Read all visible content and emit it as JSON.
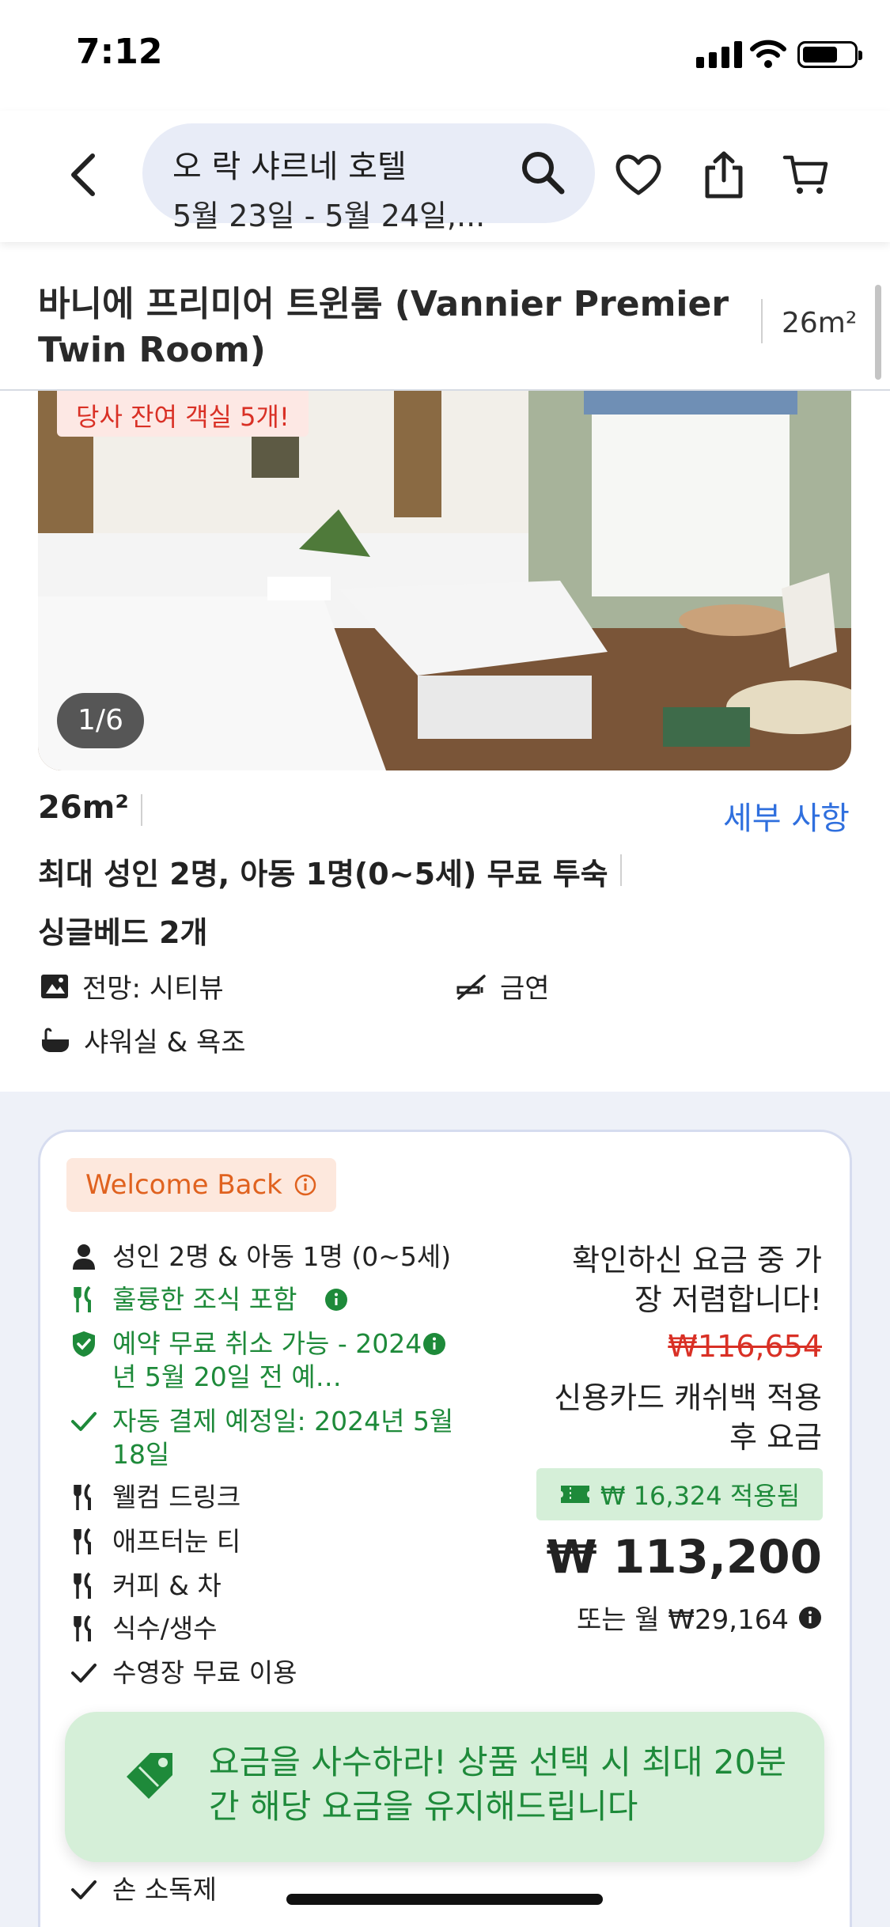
{
  "status_bar": {
    "time": "7:12"
  },
  "header": {
    "hotel_name": "오 락 샤르네 호텔",
    "dates": "5월 23일 - 5월 24일,..."
  },
  "room": {
    "title": "바니에 프리미어 트윈룸 (Vannier Premier Twin Room)",
    "size_top": "26m²",
    "scarcity_badge": "당사 잔여 객실 5개!",
    "photo_counter": "1/6",
    "size": "26m²",
    "details_link": "세부 사항",
    "occupancy": "최대 성인 2명, 아동 1명(0~5세) 무료 투숙",
    "beds": "싱글베드 2개",
    "amenities": [
      {
        "icon": "view-icon",
        "label": "전망: 시티뷰"
      },
      {
        "icon": "no-smoking-icon",
        "label": "금연"
      },
      {
        "icon": "bathtub-icon",
        "label": "샤워실 & 욕조"
      }
    ]
  },
  "offer": {
    "welcome_badge": "Welcome Back",
    "features": [
      {
        "icon": "person-icon",
        "label": "성인 2명 & 아동 1명 (0~5세)",
        "green": false
      },
      {
        "icon": "utensils-icon",
        "label": "훌륭한 조식 포함",
        "green": true
      },
      {
        "icon": "shield-check-icon",
        "label": "예약 무료 취소 가능 - 2024년 5월 20일 전 예…",
        "green": true
      },
      {
        "icon": "check-icon",
        "label": "자동 결제 예정일: 2024년 5월 18일",
        "green": true
      },
      {
        "icon": "utensils-icon",
        "label": "웰컴 드링크",
        "green": false
      },
      {
        "icon": "utensils-icon",
        "label": "애프터눈 티",
        "green": false
      },
      {
        "icon": "utensils-icon",
        "label": "커피 & 차",
        "green": false
      },
      {
        "icon": "utensils-icon",
        "label": "식수/생수",
        "green": false
      },
      {
        "icon": "check-icon",
        "label": "수영장 무료 이용",
        "green": false
      },
      {
        "icon": "check-icon",
        "label": "손 소독제",
        "green": false
      }
    ],
    "cheapest_note": "확인하신 요금 중 가장 저렴합니다!",
    "original_price": "₩116,654",
    "cashback_note": "신용카드 캐쉬백 적용 후 요금",
    "cashback_applied": "₩ 16,324 적용됨",
    "final_price": "₩ 113,200",
    "monthly": "또는 월 ₩29,164"
  },
  "toast": {
    "message": "요금을 사수하라! 상품 선택 시 최대 20분간 해당 요금을 유지해드립니다"
  },
  "colors": {
    "accent_blue": "#2f6fde",
    "green": "#1e8a3a",
    "red": "#d93025",
    "orange": "#e0621f",
    "search_bg": "#e8ecf7"
  }
}
